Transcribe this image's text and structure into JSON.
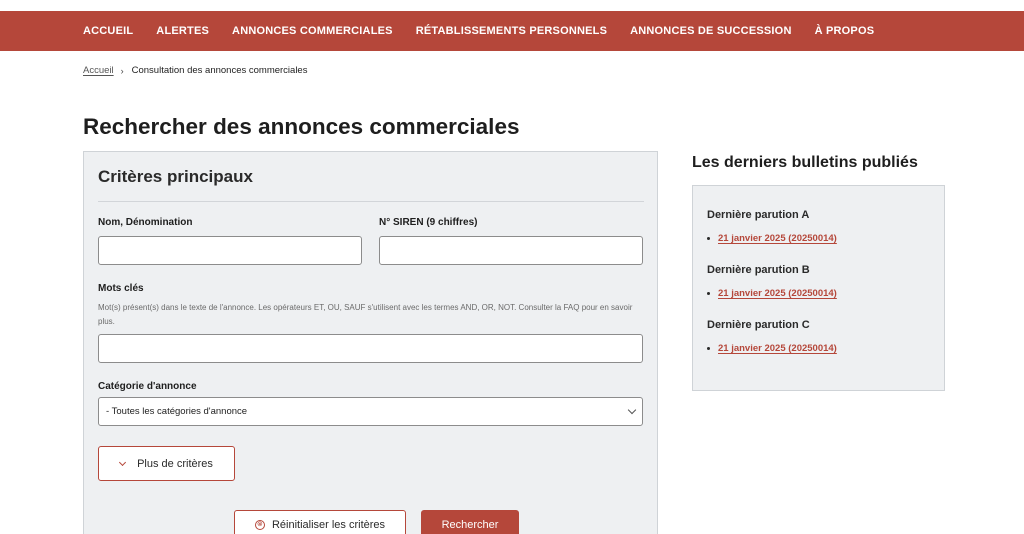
{
  "nav": {
    "items": [
      {
        "label": "ACCUEIL"
      },
      {
        "label": "ALERTES"
      },
      {
        "label": "ANNONCES COMMERCIALES"
      },
      {
        "label": "RÉTABLISSEMENTS PERSONNELS"
      },
      {
        "label": "ANNONCES DE SUCCESSION"
      },
      {
        "label": "À PROPOS"
      }
    ]
  },
  "breadcrumb": {
    "home": "Accueil",
    "separator": "›",
    "current": "Consultation des annonces commerciales"
  },
  "page_title": "Rechercher des annonces commerciales",
  "form": {
    "title": "Critères principaux",
    "name_label": "Nom, Dénomination",
    "name_value": "",
    "siren_label": "N° SIREN (9 chiffres)",
    "siren_value": "",
    "keywords_label": "Mots clés",
    "keywords_hint": "Mot(s) présent(s) dans le texte de l'annonce. Les opérateurs ET, OU, SAUF s'utilisent avec les termes AND, OR, NOT. Consulter la FAQ pour en savoir plus.",
    "keywords_value": "",
    "category_label": "Catégorie d'annonce",
    "category_selected": "- Toutes les catégories d'annonce",
    "more_criteria_label": "Plus de critères",
    "reset_label": "Réinitialiser les critères",
    "reset_icon": "⊗",
    "search_label": "Rechercher"
  },
  "sidebar": {
    "title": "Les derniers bulletins publiés",
    "bulletins": [
      {
        "title": "Dernière parution A",
        "link": "21 janvier 2025 (20250014)"
      },
      {
        "title": "Dernière parution B",
        "link": "21 janvier 2025 (20250014)"
      },
      {
        "title": "Dernière parution C",
        "link": "21 janvier 2025 (20250014)"
      }
    ]
  },
  "colors": {
    "brand": "#b5473a",
    "panel_bg": "#eef0f2"
  }
}
